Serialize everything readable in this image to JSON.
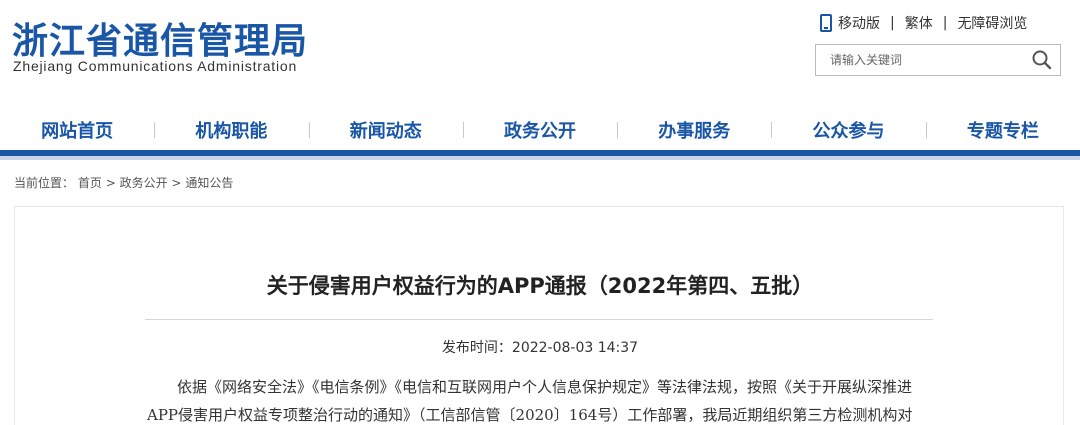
{
  "header": {
    "logo_cn": "浙江省通信管理局",
    "logo_en": "Zhejiang Communications Administration",
    "links": {
      "mobile": "移动版",
      "traditional": "繁体",
      "accessible": "无障碍浏览",
      "separator": "|"
    },
    "search": {
      "placeholder": "请输入关键词"
    }
  },
  "nav": [
    "网站首页",
    "机构职能",
    "新闻动态",
    "政务公开",
    "办事服务",
    "公众参与",
    "专题专栏"
  ],
  "breadcrumb": {
    "label": "当前位置：",
    "items": [
      "首页",
      "政务公开",
      "通知公告"
    ],
    "separator": ">"
  },
  "article": {
    "title": "关于侵害用户权益行为的APP通报（2022年第四、五批）",
    "publish_time": "发布时间：2022-08-03 14:37",
    "body": "依据《网络安全法》《电信条例》《电信和互联网用户个人信息保护规定》等法律法规，按照《关于开展纵深推进APP侵害用户权益专项整治行动的通知》（工信部信管〔2020〕164号）工作部署，我局近期组织第三方检测机构对"
  },
  "colors": {
    "brand": "#1a56a6",
    "nav_bar_light": "#c9d6e8"
  },
  "icons": {
    "mobile": "mobile-phone-icon",
    "search": "search-icon"
  }
}
